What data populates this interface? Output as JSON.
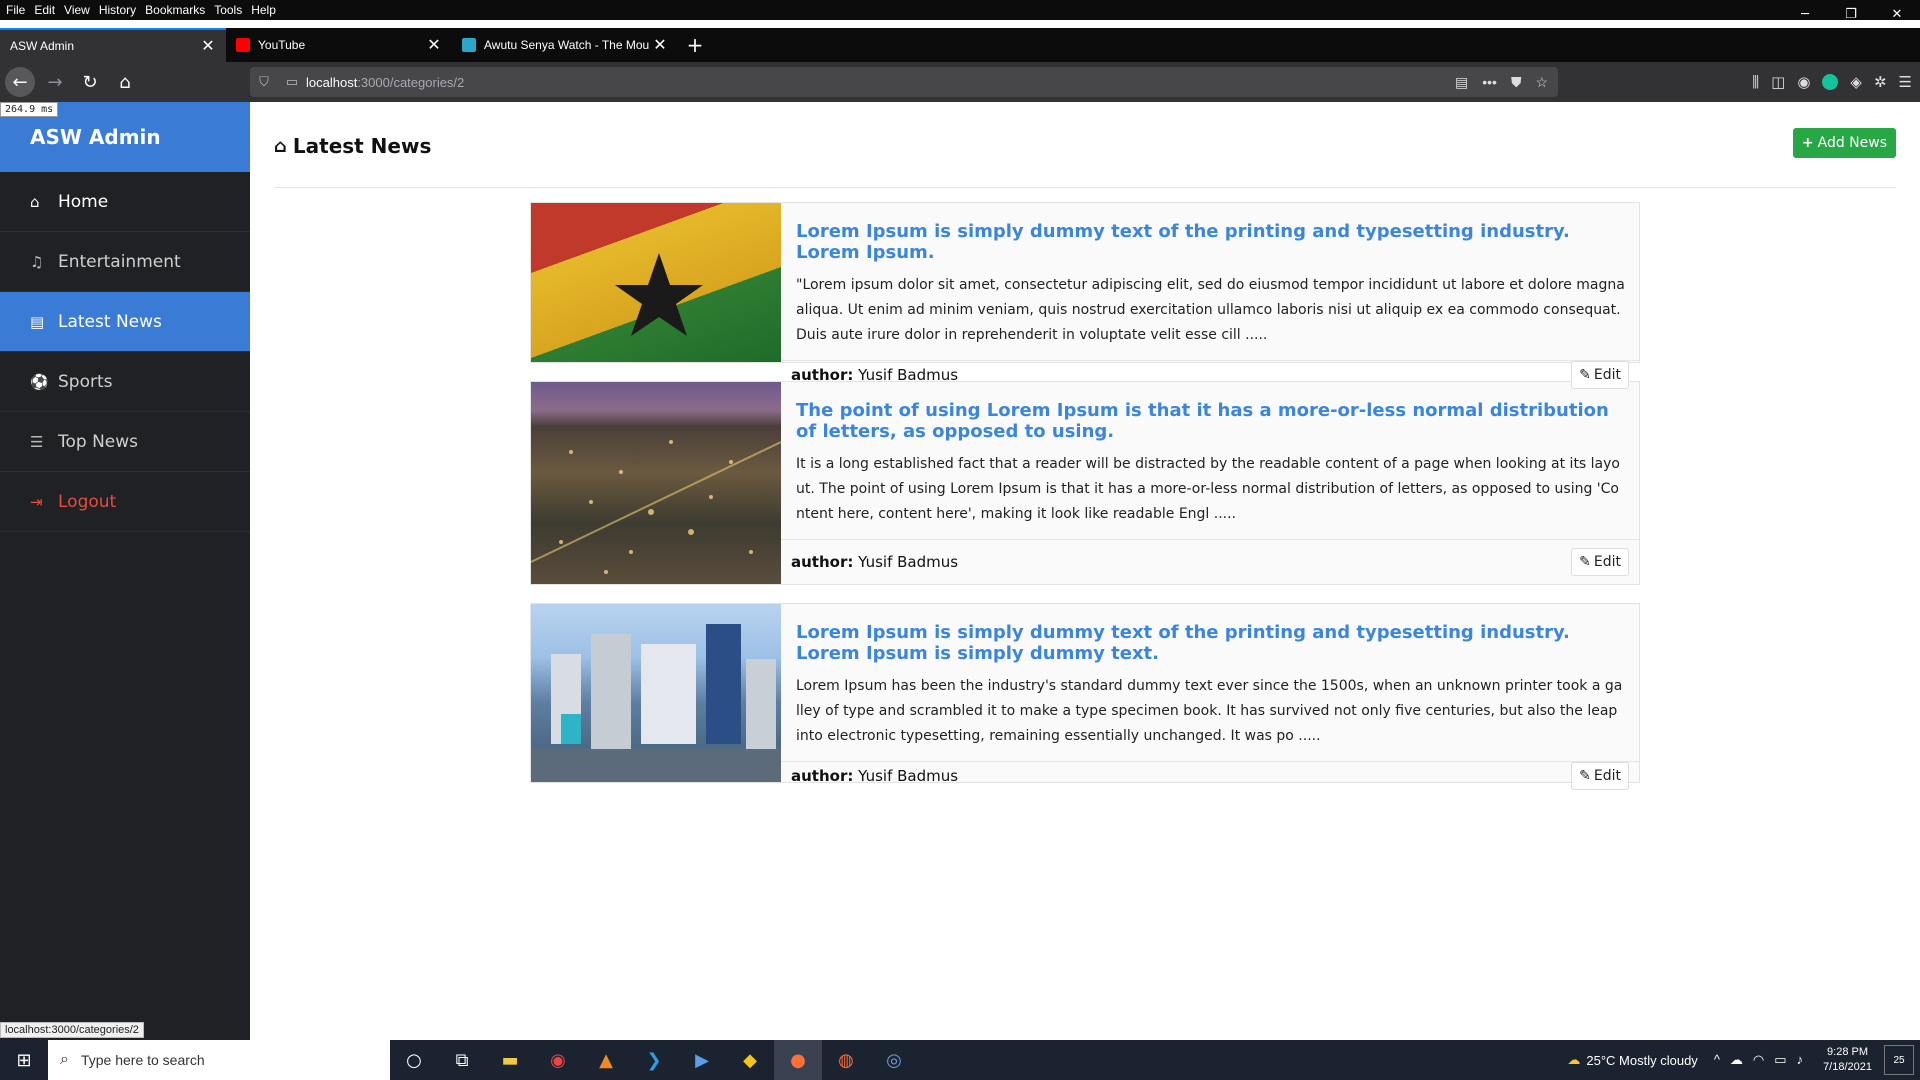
{
  "browser": {
    "menu": [
      "File",
      "Edit",
      "View",
      "History",
      "Bookmarks",
      "Tools",
      "Help"
    ],
    "tabs": [
      {
        "title": "ASW Admin",
        "close": "✕"
      },
      {
        "title": "YouTube",
        "close": "✕"
      },
      {
        "title": "Awutu Senya Watch - The Mou",
        "close": "✕"
      }
    ],
    "new_tab": "+",
    "url_host": "localhost",
    "url_path": ":3000/categories/2",
    "timing": "264.9 ms",
    "status_url": "localhost:3000/categories/2"
  },
  "sidebar": {
    "brand": "ASW Admin",
    "items": [
      {
        "label": "Home",
        "icon": "home-icon"
      },
      {
        "label": "Entertainment",
        "icon": "music-icon"
      },
      {
        "label": "Latest News",
        "icon": "newspaper-icon"
      },
      {
        "label": "Sports",
        "icon": "soccer-ball-icon"
      },
      {
        "label": "Top News",
        "icon": "list-icon"
      },
      {
        "label": "Logout",
        "icon": "sign-out-icon"
      }
    ]
  },
  "main": {
    "title": "Latest News",
    "add_button": "Add News",
    "author_label": "author:",
    "edit_label": "Edit",
    "news": [
      {
        "title": "Lorem Ipsum is simply dummy text of the printing and typesetting industry. Lorem Ipsum.",
        "excerpt": "\"Lorem ipsum dolor sit amet, consectetur adipiscing elit, sed do eiusmod tempor incididunt ut labore et dolore magna aliqua. Ut enim ad minim veniam, quis nostrud exercitation ullamco laboris nisi ut aliquip ex ea commodo consequat. Duis aute irure dolor in reprehenderit in voluptate velit esse cill .....",
        "author": "Yusif Badmus"
      },
      {
        "title": "The point of using Lorem Ipsum is that it has a more-or-less normal distribution of letters, as opposed to using.",
        "excerpt": "It is a long established fact that a reader will be distracted by the readable content of a page when looking at its layout. The point of using Lorem Ipsum is that it has a more-or-less normal distribution of letters, as opposed to using 'Content here, content here', making it look like readable Engl .....",
        "author": "Yusif Badmus"
      },
      {
        "title": "Lorem Ipsum is simply dummy text of the printing and typesetting industry. Lorem Ipsum is simply dummy text.",
        "excerpt": "Lorem Ipsum has been the industry's standard dummy text ever since the 1500s, when an unknown printer took a galley of type and scrambled it to make a type specimen book. It has survived not only five centuries, but also the leap into electronic typesetting, remaining essentially unchanged. It was po .....",
        "author": "Yusif Badmus"
      }
    ]
  },
  "taskbar": {
    "search_placeholder": "Type here to search",
    "weather": "25°C  Mostly cloudy",
    "time": "9:28 PM",
    "date": "7/18/2021",
    "notifications": "25"
  },
  "colors": {
    "brand": "#3a7bd5",
    "sidebar_bg": "#202124",
    "title_link": "#3a86dc",
    "add_button": "#28a745",
    "logout": "#e74c3c"
  }
}
